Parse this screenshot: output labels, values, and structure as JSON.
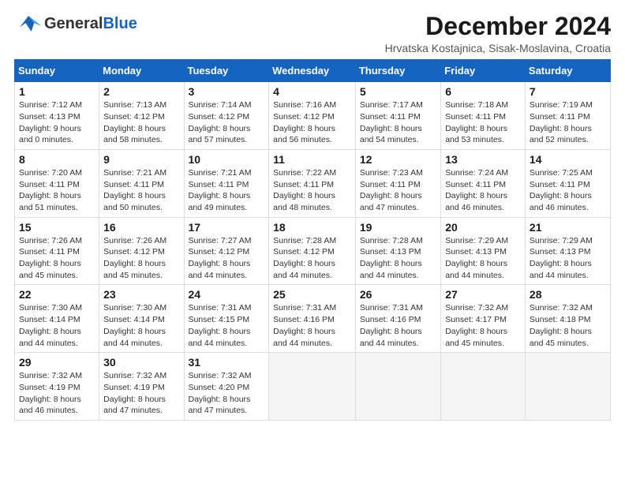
{
  "header": {
    "logo_general": "General",
    "logo_blue": "Blue",
    "main_title": "December 2024",
    "subtitle": "Hrvatska Kostajnica, Sisak-Moslavina, Croatia"
  },
  "weekdays": [
    "Sunday",
    "Monday",
    "Tuesday",
    "Wednesday",
    "Thursday",
    "Friday",
    "Saturday"
  ],
  "weeks": [
    [
      {
        "day": "1",
        "sunrise": "7:12 AM",
        "sunset": "4:13 PM",
        "daylight": "9 hours and 0 minutes."
      },
      {
        "day": "2",
        "sunrise": "7:13 AM",
        "sunset": "4:12 PM",
        "daylight": "8 hours and 58 minutes."
      },
      {
        "day": "3",
        "sunrise": "7:14 AM",
        "sunset": "4:12 PM",
        "daylight": "8 hours and 57 minutes."
      },
      {
        "day": "4",
        "sunrise": "7:16 AM",
        "sunset": "4:12 PM",
        "daylight": "8 hours and 56 minutes."
      },
      {
        "day": "5",
        "sunrise": "7:17 AM",
        "sunset": "4:11 PM",
        "daylight": "8 hours and 54 minutes."
      },
      {
        "day": "6",
        "sunrise": "7:18 AM",
        "sunset": "4:11 PM",
        "daylight": "8 hours and 53 minutes."
      },
      {
        "day": "7",
        "sunrise": "7:19 AM",
        "sunset": "4:11 PM",
        "daylight": "8 hours and 52 minutes."
      }
    ],
    [
      {
        "day": "8",
        "sunrise": "7:20 AM",
        "sunset": "4:11 PM",
        "daylight": "8 hours and 51 minutes."
      },
      {
        "day": "9",
        "sunrise": "7:21 AM",
        "sunset": "4:11 PM",
        "daylight": "8 hours and 50 minutes."
      },
      {
        "day": "10",
        "sunrise": "7:21 AM",
        "sunset": "4:11 PM",
        "daylight": "8 hours and 49 minutes."
      },
      {
        "day": "11",
        "sunrise": "7:22 AM",
        "sunset": "4:11 PM",
        "daylight": "8 hours and 48 minutes."
      },
      {
        "day": "12",
        "sunrise": "7:23 AM",
        "sunset": "4:11 PM",
        "daylight": "8 hours and 47 minutes."
      },
      {
        "day": "13",
        "sunrise": "7:24 AM",
        "sunset": "4:11 PM",
        "daylight": "8 hours and 46 minutes."
      },
      {
        "day": "14",
        "sunrise": "7:25 AM",
        "sunset": "4:11 PM",
        "daylight": "8 hours and 46 minutes."
      }
    ],
    [
      {
        "day": "15",
        "sunrise": "7:26 AM",
        "sunset": "4:11 PM",
        "daylight": "8 hours and 45 minutes."
      },
      {
        "day": "16",
        "sunrise": "7:26 AM",
        "sunset": "4:12 PM",
        "daylight": "8 hours and 45 minutes."
      },
      {
        "day": "17",
        "sunrise": "7:27 AM",
        "sunset": "4:12 PM",
        "daylight": "8 hours and 44 minutes."
      },
      {
        "day": "18",
        "sunrise": "7:28 AM",
        "sunset": "4:12 PM",
        "daylight": "8 hours and 44 minutes."
      },
      {
        "day": "19",
        "sunrise": "7:28 AM",
        "sunset": "4:13 PM",
        "daylight": "8 hours and 44 minutes."
      },
      {
        "day": "20",
        "sunrise": "7:29 AM",
        "sunset": "4:13 PM",
        "daylight": "8 hours and 44 minutes."
      },
      {
        "day": "21",
        "sunrise": "7:29 AM",
        "sunset": "4:13 PM",
        "daylight": "8 hours and 44 minutes."
      }
    ],
    [
      {
        "day": "22",
        "sunrise": "7:30 AM",
        "sunset": "4:14 PM",
        "daylight": "8 hours and 44 minutes."
      },
      {
        "day": "23",
        "sunrise": "7:30 AM",
        "sunset": "4:14 PM",
        "daylight": "8 hours and 44 minutes."
      },
      {
        "day": "24",
        "sunrise": "7:31 AM",
        "sunset": "4:15 PM",
        "daylight": "8 hours and 44 minutes."
      },
      {
        "day": "25",
        "sunrise": "7:31 AM",
        "sunset": "4:16 PM",
        "daylight": "8 hours and 44 minutes."
      },
      {
        "day": "26",
        "sunrise": "7:31 AM",
        "sunset": "4:16 PM",
        "daylight": "8 hours and 44 minutes."
      },
      {
        "day": "27",
        "sunrise": "7:32 AM",
        "sunset": "4:17 PM",
        "daylight": "8 hours and 45 minutes."
      },
      {
        "day": "28",
        "sunrise": "7:32 AM",
        "sunset": "4:18 PM",
        "daylight": "8 hours and 45 minutes."
      }
    ],
    [
      {
        "day": "29",
        "sunrise": "7:32 AM",
        "sunset": "4:19 PM",
        "daylight": "8 hours and 46 minutes."
      },
      {
        "day": "30",
        "sunrise": "7:32 AM",
        "sunset": "4:19 PM",
        "daylight": "8 hours and 47 minutes."
      },
      {
        "day": "31",
        "sunrise": "7:32 AM",
        "sunset": "4:20 PM",
        "daylight": "8 hours and 47 minutes."
      },
      null,
      null,
      null,
      null
    ]
  ]
}
